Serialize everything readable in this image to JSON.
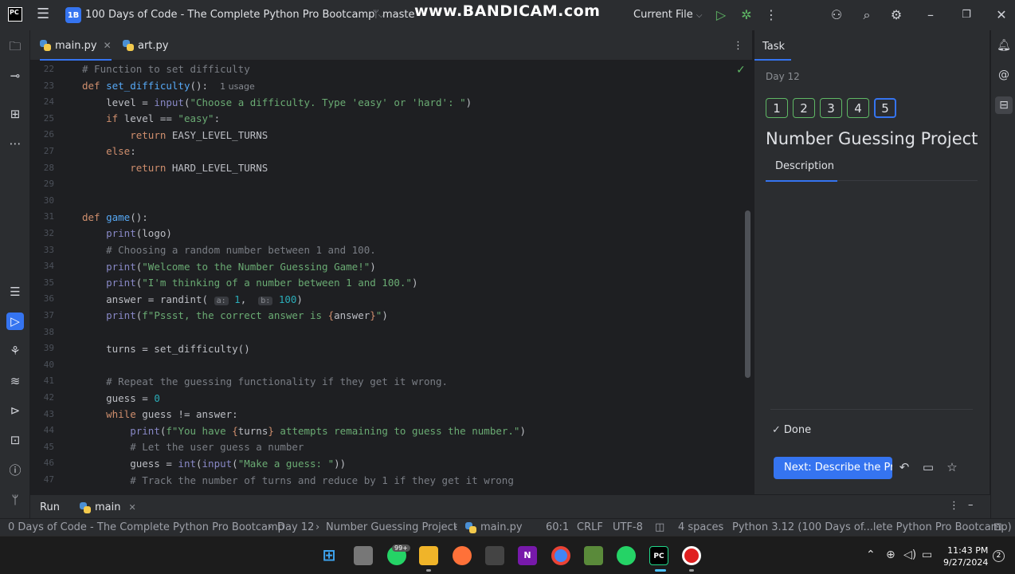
{
  "titlebar": {
    "project_badge": "1B",
    "project_name": "100 Days of Code - The Complete Python Pro Bootcamp",
    "branch": "maste",
    "watermark": "www.BANDICAM.com",
    "run_config": "Current File"
  },
  "tabs": [
    {
      "label": "main.py",
      "active": true
    },
    {
      "label": "art.py",
      "active": false
    }
  ],
  "editor": {
    "line_numbers": [
      "22",
      "23",
      "24",
      "25",
      "26",
      "27",
      "28",
      "29",
      "30",
      "31",
      "32",
      "33",
      "34",
      "35",
      "36",
      "37",
      "38",
      "39",
      "40",
      "41",
      "42",
      "43",
      "44",
      "45",
      "46",
      "47"
    ],
    "usage_hint": "1 usage",
    "param_a": "a:",
    "param_b": "b:"
  },
  "task": {
    "title": "Task",
    "day": "Day 12",
    "steps": [
      "1",
      "2",
      "3",
      "4",
      "5"
    ],
    "heading": "Number Guessing Project",
    "description_tab": "Description",
    "done_label": "Done",
    "next_button": "Next: Describe the Pro..."
  },
  "runbar": {
    "label": "Run",
    "config": "main"
  },
  "statusbar": {
    "breadcrumb": [
      "0 Days of Code - The Complete Python Pro Bootcamp",
      "Day 12",
      "Number Guessing Project",
      "main.py"
    ],
    "position": "60:1",
    "line_ending": "CRLF",
    "encoding": "UTF-8",
    "indent": "4 spaces",
    "interpreter": "Python 3.12 (100 Days of...lete Python Pro Bootcamp)"
  },
  "taskbar": {
    "whatsapp_badge": "99+",
    "time": "11:43 PM",
    "date": "9/27/2024",
    "notifications": "2"
  }
}
